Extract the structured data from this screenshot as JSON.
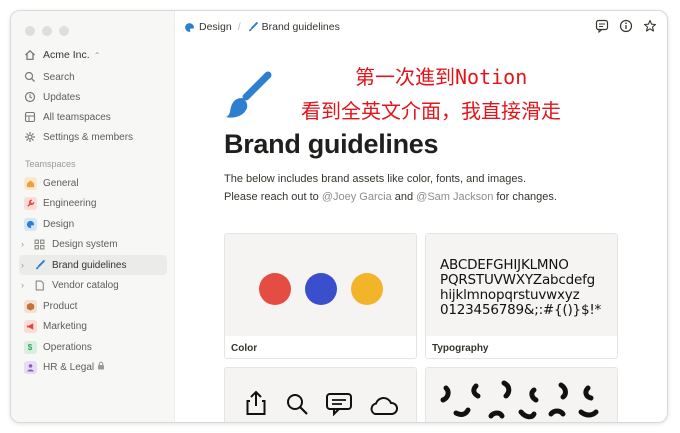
{
  "sidebar": {
    "workspace": "Acme Inc.",
    "nav": [
      {
        "label": "Search",
        "icon": "search-icon"
      },
      {
        "label": "Updates",
        "icon": "clock-icon"
      },
      {
        "label": "All teamspaces",
        "icon": "teamspaces-icon"
      },
      {
        "label": "Settings & members",
        "icon": "gear-icon"
      }
    ],
    "section_title": "Teamspaces",
    "teamspaces": [
      {
        "label": "General",
        "icon": "house-icon",
        "color": "#e9a23b"
      },
      {
        "label": "Engineering",
        "icon": "wrench-icon",
        "color": "#e0453a"
      },
      {
        "label": "Design",
        "icon": "palette-icon",
        "color": "#2f7fd1"
      },
      {
        "label": "Design system",
        "icon": "grid-icon",
        "color": "#9b9a97"
      },
      {
        "label": "Brand guidelines",
        "icon": "paintbrush-icon",
        "color": "#2f7fd1"
      },
      {
        "label": "Vendor catalog",
        "icon": "document-icon",
        "color": "#9b9a97"
      },
      {
        "label": "Product",
        "icon": "box-icon",
        "color": "#c4723a"
      },
      {
        "label": "Marketing",
        "icon": "megaphone-icon",
        "color": "#e0453a"
      },
      {
        "label": "Operations",
        "icon": "dollar-icon",
        "color": "#3aa560"
      },
      {
        "label": "HR & Legal",
        "icon": "person-icon",
        "color": "#8b5cc6"
      }
    ]
  },
  "breadcrumb": {
    "parent": "Design",
    "current": "Brand guidelines"
  },
  "page": {
    "title": "Brand guidelines",
    "desc_line1": "The below includes brand assets like color, fonts, and images.",
    "desc_pre": "Please reach out to ",
    "mention1": "@Joey Garcia",
    "desc_mid": " and ",
    "mention2": "@Sam Jackson",
    "desc_post": " for changes."
  },
  "cards": {
    "color_label": "Color",
    "typography_label": "Typography",
    "colors": [
      "#e54d42",
      "#3a4fcb",
      "#f4b42a"
    ],
    "typo_lines": [
      "ABCDEFGHIJKLMNO",
      "PQRSTUVWXYZabcdefg",
      "hijklmnopqrstuvwxyz",
      "0123456789&;:#{()}$!*"
    ]
  },
  "overlay": {
    "line1": "第一次進到Notion",
    "line2": "看到全英文介面，我直接滑走"
  },
  "accent": "#2f7fd1"
}
